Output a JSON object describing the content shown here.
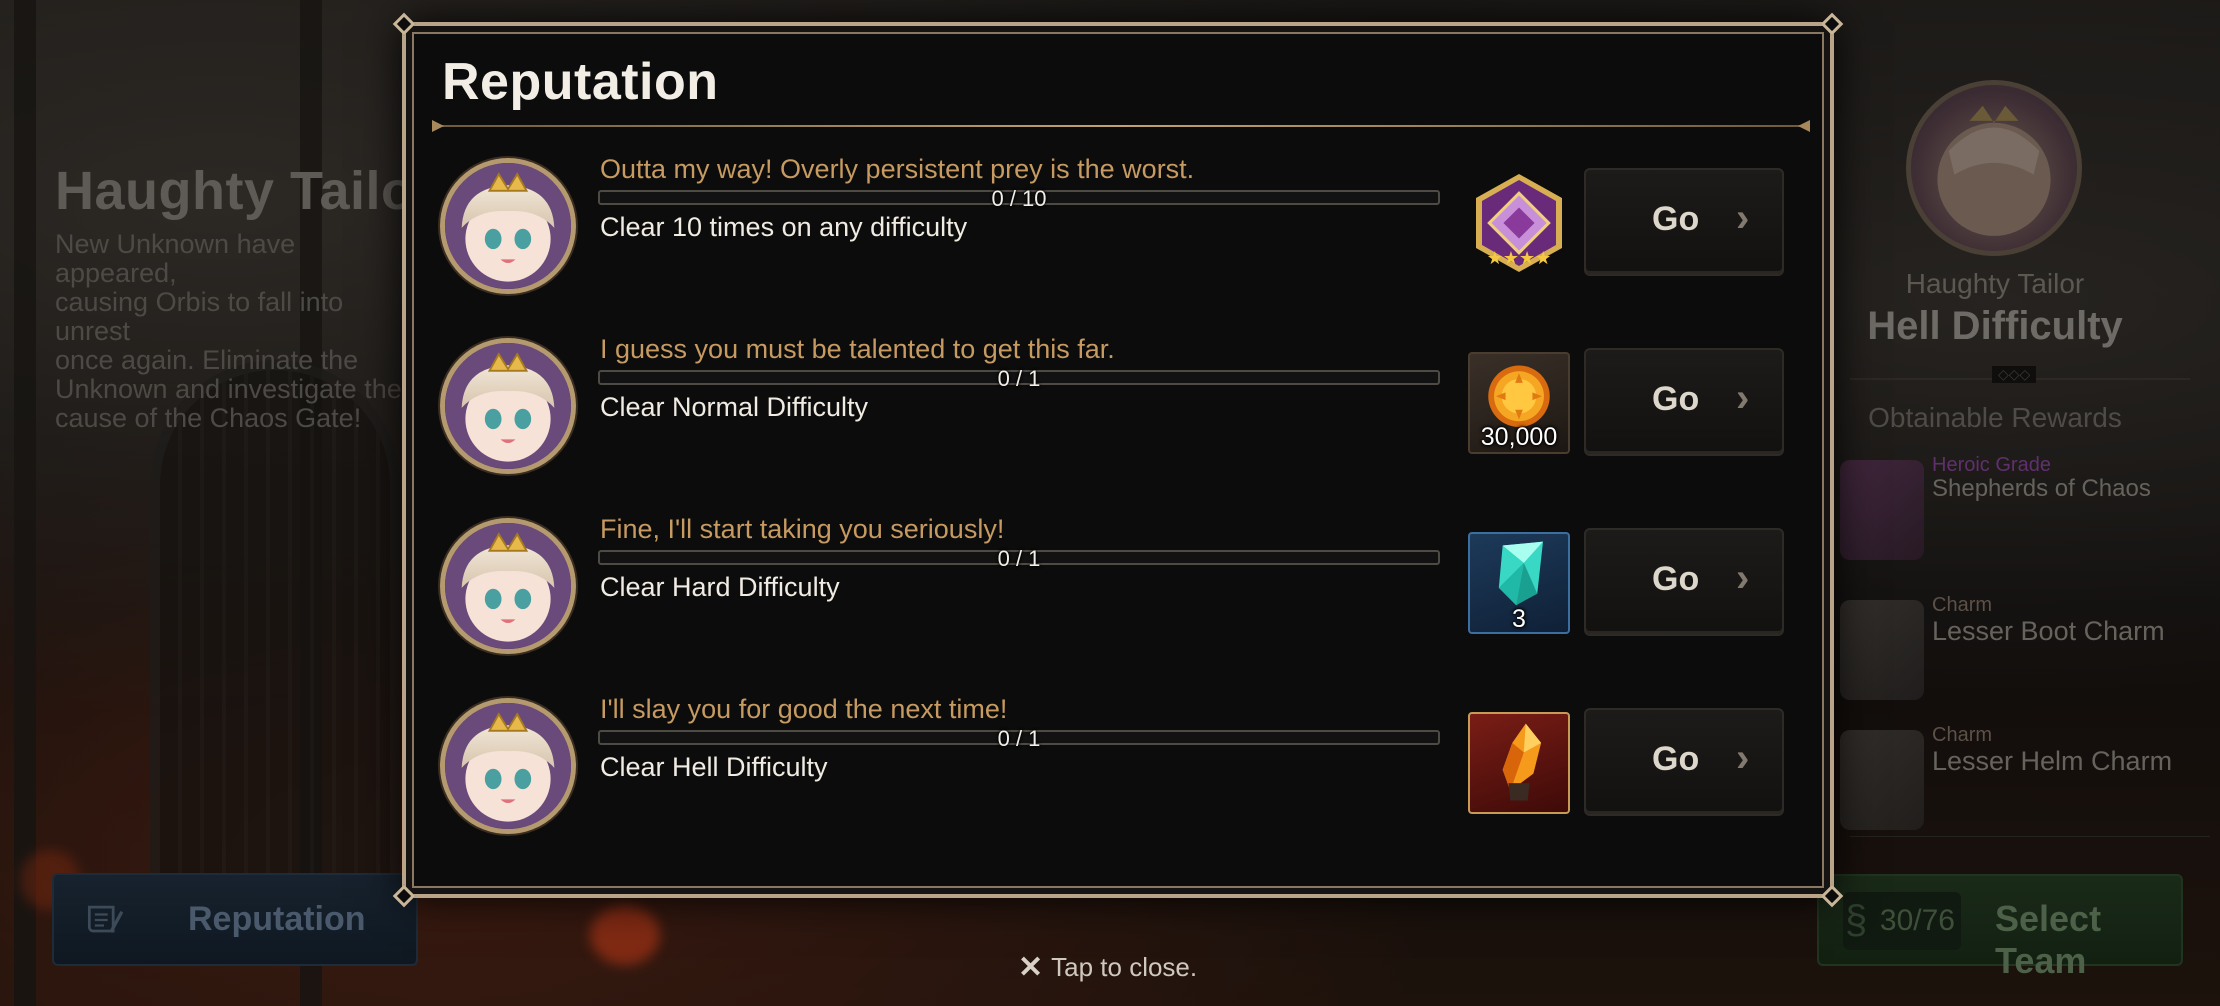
{
  "background": {
    "stage_title": "Haughty Tailor",
    "stage_description": "New Unknown have appeared,\ncausing Orbis to fall into unrest\nonce again. Eliminate the\nUnknown and investigate the\ncause of the Chaos Gate!",
    "reputation_tab_label": "Reputation",
    "boss_name": "Haughty Tailor",
    "difficulty": "Hell Difficulty",
    "obtainable_rewards_label": "Obtainable Rewards",
    "rewards": [
      {
        "grade": "Heroic Grade",
        "name": "Shepherds of Chaos",
        "icon": "artifact-icon"
      },
      {
        "grade": "Charm",
        "name": "Lesser Boot Charm",
        "icon": "charm-icon"
      },
      {
        "grade": "Charm",
        "name": "Lesser Helm Charm",
        "icon": "charm-icon"
      }
    ],
    "stamina": "30/76",
    "select_team_label": "Select Team"
  },
  "modal": {
    "title": "Reputation",
    "missions": [
      {
        "quote": "Outta my way! Overly persistent prey is the worst.",
        "progress_text": "0 / 10",
        "progress_fraction": 0,
        "objective": "Clear 10 times on any difficulty",
        "reward_icon": "artifact-icon",
        "reward_qty": "",
        "go_label": "Go"
      },
      {
        "quote": "I guess you must be talented to get this far.",
        "progress_text": "0 / 1",
        "progress_fraction": 0,
        "objective": "Clear Normal Difficulty",
        "reward_icon": "gold-coin-icon",
        "reward_qty": "30,000",
        "go_label": "Go"
      },
      {
        "quote": "Fine, I'll start taking you seriously!",
        "progress_text": "0 / 1",
        "progress_fraction": 0,
        "objective": "Clear Hard Difficulty",
        "reward_icon": "crystal-icon",
        "reward_qty": "3",
        "go_label": "Go"
      },
      {
        "quote": "I'll slay you for good the next time!",
        "progress_text": "0 / 1",
        "progress_fraction": 0,
        "objective": "Clear Hell Difficulty",
        "reward_icon": "catalyst-icon",
        "reward_qty": "",
        "go_label": "Go"
      }
    ]
  },
  "footer": {
    "close_hint": "Tap to close."
  },
  "colors": {
    "accent_gold": "#c69a60",
    "frame": "#b9a48a",
    "modal_bg": "#0c0c0c"
  }
}
